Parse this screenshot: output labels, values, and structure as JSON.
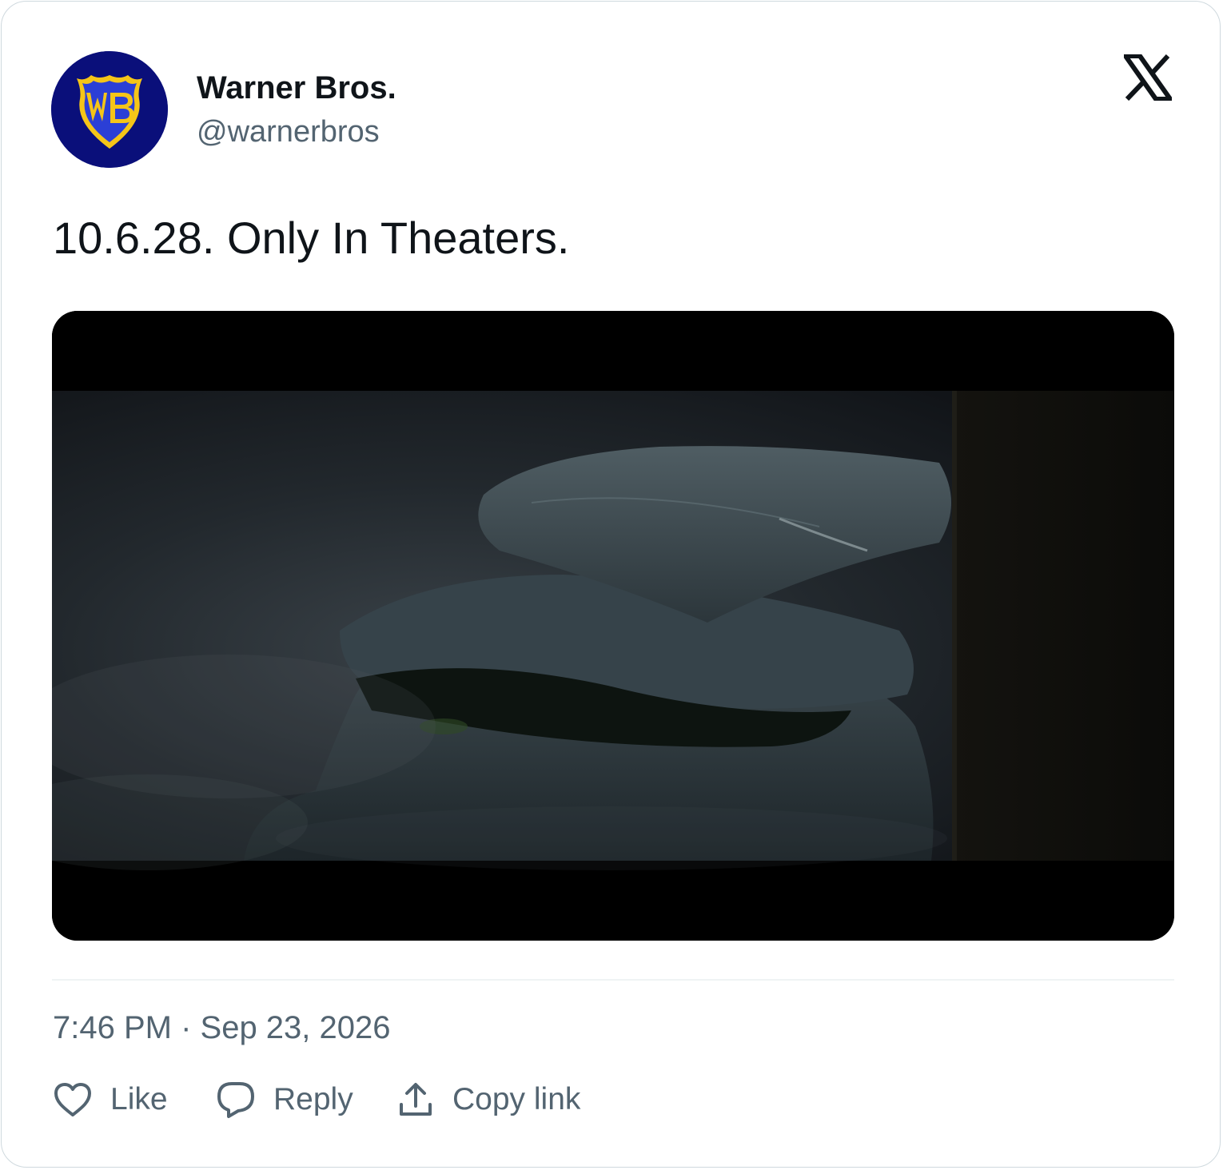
{
  "author": {
    "display_name": "Warner Bros.",
    "handle": "@warnerbros",
    "avatar_icon": "warner-bros-shield-logo",
    "avatar_bg": "#0a0f7a",
    "avatar_shield_color": "#f5c518"
  },
  "platform_icon": "x-logo-icon",
  "tweet": {
    "text": "10.6.28. Only In Theaters.",
    "media_description_icon": "video-still-backpack"
  },
  "timestamp": "7:46 PM · Sep 23, 2026",
  "actions": {
    "like_label": "Like",
    "reply_label": "Reply",
    "copy_label": "Copy link"
  },
  "colors": {
    "text_primary": "#0f1419",
    "text_secondary": "#536471",
    "border": "#cfd9de",
    "divider": "#eff3f4"
  }
}
